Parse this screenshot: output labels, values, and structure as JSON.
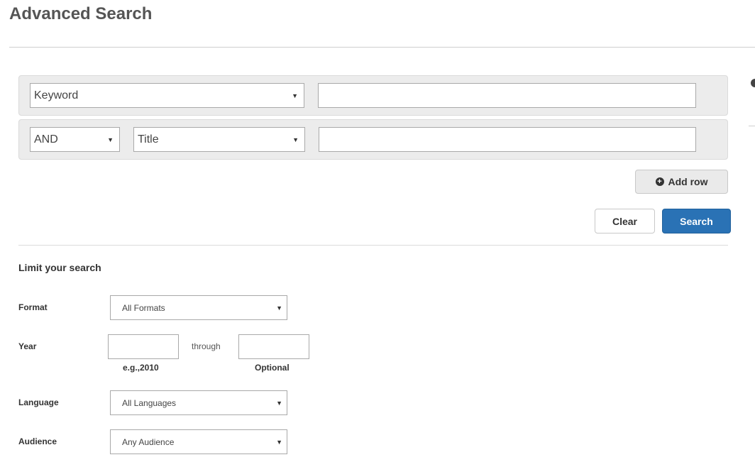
{
  "page": {
    "title": "Advanced Search"
  },
  "search_rows": {
    "row1": {
      "field": "Keyword",
      "value": ""
    },
    "row2": {
      "operator": "AND",
      "field": "Title",
      "value": ""
    }
  },
  "actions": {
    "add_row": "Add row",
    "clear": "Clear",
    "search": "Search"
  },
  "limits": {
    "heading": "Limit your search",
    "format": {
      "label": "Format",
      "value": "All Formats"
    },
    "year": {
      "label": "Year",
      "through": "through",
      "from_hint": "e.g.,2010",
      "to_hint": "Optional",
      "from_value": "",
      "to_value": ""
    },
    "language": {
      "label": "Language",
      "value": "All Languages"
    },
    "audience": {
      "label": "Audience",
      "value": "Any Audience"
    }
  },
  "colors": {
    "primary": "#2a72b5",
    "panel": "#ececec"
  }
}
